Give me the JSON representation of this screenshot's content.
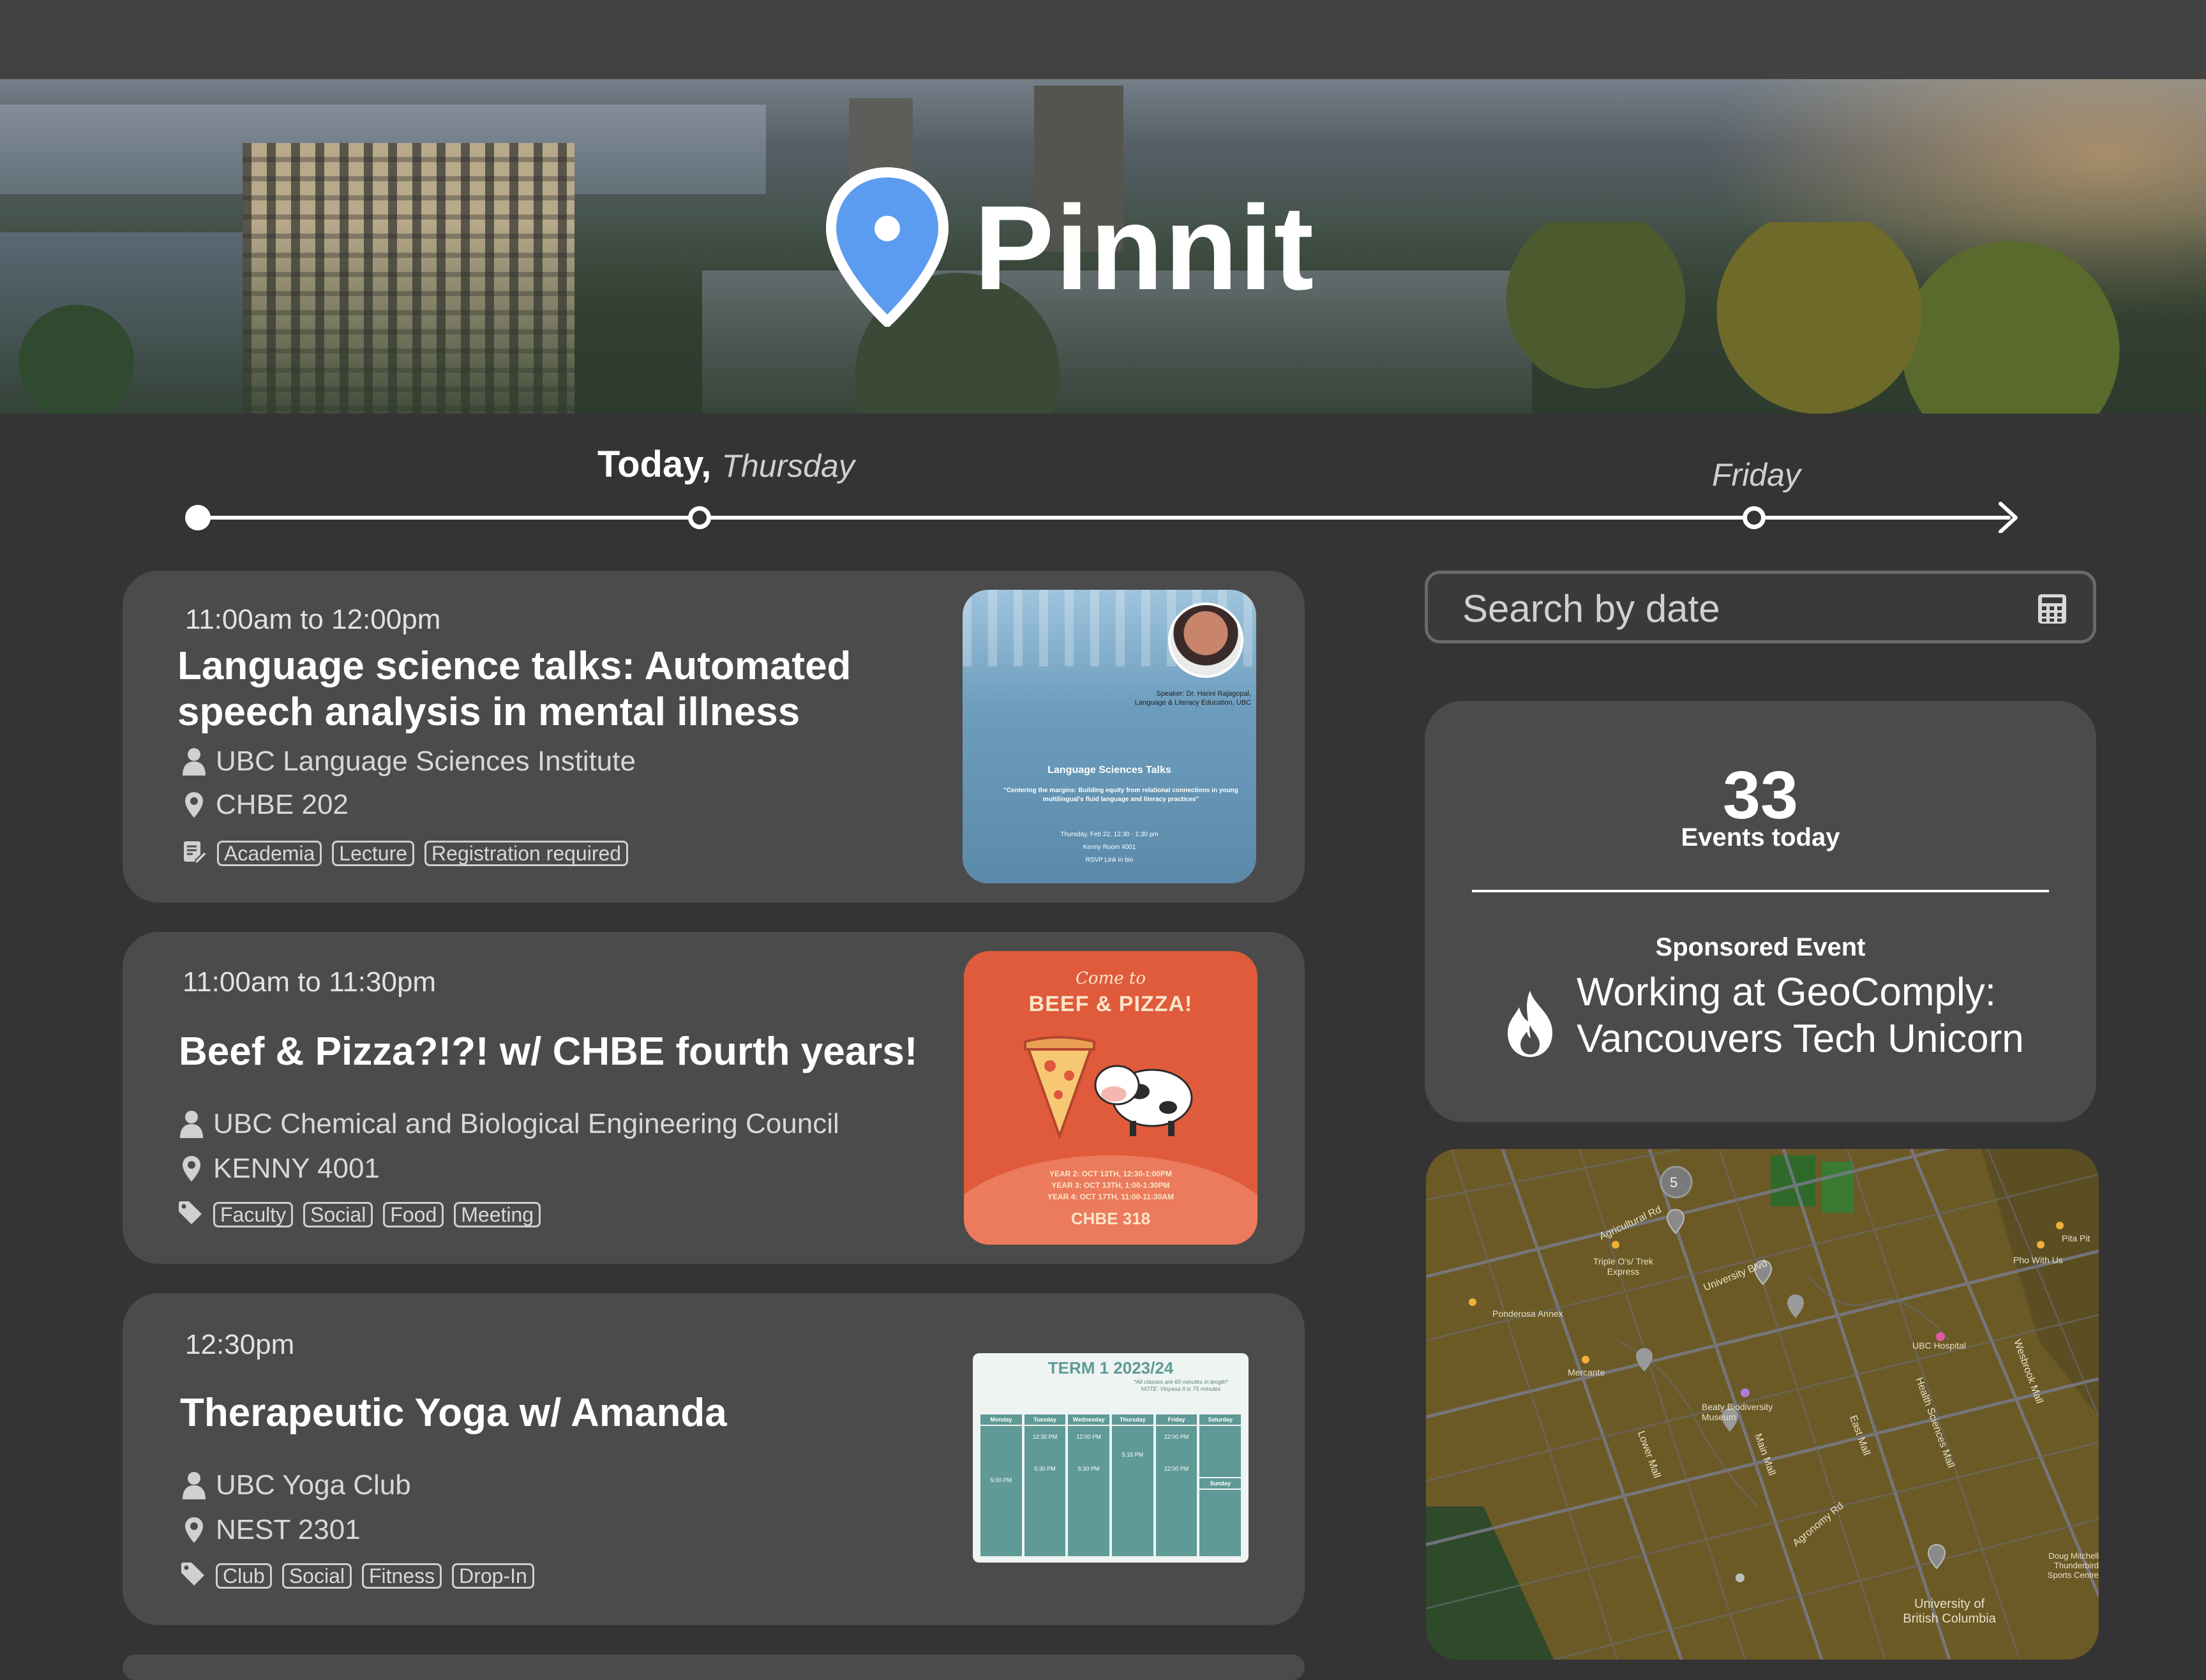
{
  "app": {
    "name": "Pinnit"
  },
  "timeline": {
    "today_label": "Today,",
    "today_day": "Thursday",
    "next_day": "Friday",
    "more": "•••"
  },
  "events": [
    {
      "time": "11:00am to 12:00pm",
      "title": "Language science talks: Automated speech analysis in mental illness",
      "organizer": "UBC Language Sciences Institute",
      "location": "CHBE 202",
      "tags": [
        "Academia",
        "Lecture",
        "Registration required"
      ],
      "poster": {
        "speaker": "Speaker: Dr. Harini Rajagopal,",
        "speaker_dept": "Language & Literacy Education, UBC",
        "series": "Language Sciences Talks",
        "talk": "\"Centering the margins: Building equity from relational connections in young multilingual's fluid language and literacy practices\"",
        "date": "Thursday, Feb 22, 12:30 - 1:30 pm",
        "room": "Kenny Room 4001",
        "rsvp": "RSVP Link in bio"
      }
    },
    {
      "time": "11:00am to 11:30pm",
      "title": "Beef & Pizza?!?! w/ CHBE fourth years!",
      "organizer": "UBC Chemical and Biological Engineering Council",
      "location": "KENNY 4001",
      "tags": [
        "Faculty",
        "Social",
        "Food",
        "Meeting"
      ],
      "poster": {
        "line1": "Come to",
        "line2": "BEEF & PIZZA!",
        "y2": "YEAR 2: OCT 13TH, 12:30-1:00PM",
        "y3": "YEAR 3: OCT 13TH, 1:00-1:30PM",
        "y4": "YEAR 4: OCT 17TH, 11:00-11:30AM",
        "room": "CHBE 318"
      }
    },
    {
      "time": "12:30pm",
      "title": "Therapeutic Yoga w/ Amanda",
      "organizer": "UBC Yoga Club",
      "location": "NEST 2301",
      "tags": [
        "Club",
        "Social",
        "Fitness",
        "Drop-In"
      ],
      "poster": {
        "heading": "TERM 1 2023/24",
        "note1": "*All classes are 60 minutes in length*",
        "note2": "NOTE: Vinyasa II is 75 minutes",
        "days": [
          "Monday",
          "Tuesday",
          "Wednesday",
          "Thursday",
          "Friday",
          "Saturday"
        ],
        "sunday": "Sunday",
        "times": [
          "12:30 PM",
          "12:00 PM",
          "12:00 PM",
          "5:00 PM",
          "5:30 PM",
          "5:30 PM",
          "5:15 PM",
          "12:00 PM"
        ]
      }
    }
  ],
  "search": {
    "placeholder": "Search by date"
  },
  "stats": {
    "count": "33",
    "count_label": "Events today",
    "sponsored_label": "Sponsored Event",
    "sponsored_title": "Working at GeoComply: Vancouvers Tech Unicorn"
  },
  "map": {
    "cluster_count": "5",
    "labels": [
      "Agricultural Rd",
      "Triple O's/ Trek Express",
      "Pita Pit",
      "Pho With Us",
      "Ponderosa Annex",
      "University Blvd",
      "UBC Hospital",
      "Mercante",
      "Beaty Biodiversity Museum",
      "Main Mall",
      "Lower Mall",
      "East Mall",
      "Health Sciences Mall",
      "Wesbrook Mall",
      "Agronomy Rd",
      "Doug Mitchell Thunderbird Sports Centre",
      "University of British Columbia"
    ]
  },
  "colors": {
    "accent": "#5b9cf0",
    "card": "#4b4b4b",
    "background": "#343434"
  }
}
